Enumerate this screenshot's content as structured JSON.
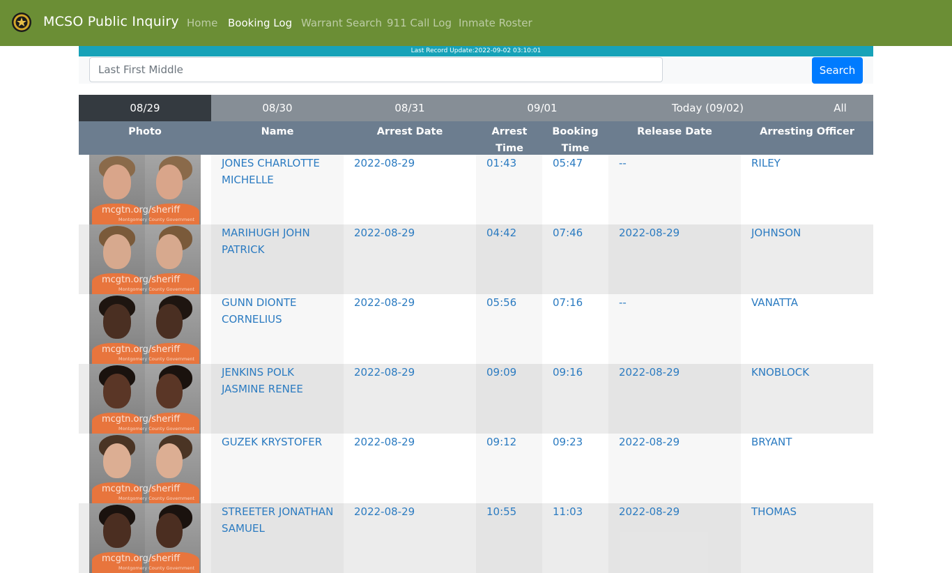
{
  "nav": {
    "brand": "MCSO Public Inquiry",
    "links": [
      "Home",
      "Booking Log",
      "Warrant Search",
      "911 Call Log",
      "Inmate Roster"
    ],
    "active": "Booking Log"
  },
  "update_text": "Last Record Update:2022-09-02 03:10:01",
  "search": {
    "placeholder": "Last First Middle",
    "value": "",
    "button": "Search"
  },
  "tabs": [
    "08/29",
    "08/30",
    "08/31",
    "09/01",
    "Today (09/02)",
    "All"
  ],
  "active_tab": "08/29",
  "columns": [
    "Photo",
    "Name",
    "Arrest Date",
    "Arrest Time",
    "Booking Time",
    "Release Date",
    "Arresting Officer"
  ],
  "rows": [
    {
      "name_line1": "JONES CHARLOTTE",
      "name_line2": "MICHELLE",
      "arrest_date": "2022-08-29",
      "arrest_time": "01:43",
      "booking_time": "05:47",
      "release_date": "--",
      "officer": "RILEY"
    },
    {
      "name_line1": "MARIHUGH JOHN",
      "name_line2": "PATRICK",
      "arrest_date": "2022-08-29",
      "arrest_time": "04:42",
      "booking_time": "07:46",
      "release_date": "2022-08-29",
      "officer": "JOHNSON"
    },
    {
      "name_line1": "GUNN DIONTE",
      "name_line2": "CORNELIUS",
      "arrest_date": "2022-08-29",
      "arrest_time": "05:56",
      "booking_time": "07:16",
      "release_date": "--",
      "officer": "VANATTA"
    },
    {
      "name_line1": "JENKINS POLK",
      "name_line2": "JASMINE RENEE",
      "arrest_date": "2022-08-29",
      "arrest_time": "09:09",
      "booking_time": "09:16",
      "release_date": "2022-08-29",
      "officer": "KNOBLOCK"
    },
    {
      "name_line1": "GUZEK KRYSTOFER",
      "name_line2": "",
      "arrest_date": "2022-08-29",
      "arrest_time": "09:12",
      "booking_time": "09:23",
      "release_date": "2022-08-29",
      "officer": "BRYANT"
    },
    {
      "name_line1": "STREETER JONATHAN",
      "name_line2": "SAMUEL",
      "arrest_date": "2022-08-29",
      "arrest_time": "10:55",
      "booking_time": "11:03",
      "release_date": "2022-08-29",
      "officer": "THOMAS"
    }
  ],
  "photo_watermark": "mcgtn.org/sheriff",
  "photo_watermark_sub": "Montgomery County Government",
  "colors": {
    "navbar": "#6b8e35",
    "update_bar": "#17a2b8",
    "active_tab": "#343a40",
    "tab_bar": "#868e96",
    "table_header": "#6c7d8f",
    "link": "#2b7bc1",
    "search_button": "#007bff"
  },
  "icons": {
    "logo": "sheriff-badge-icon"
  }
}
